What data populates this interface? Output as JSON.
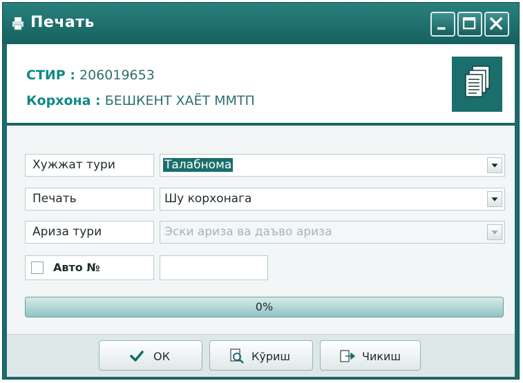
{
  "window": {
    "title": "Печать"
  },
  "header": {
    "stir_label": "СТИР :",
    "stir_value": "206019653",
    "company_label": "Корхона :",
    "company_value": "БЕШКЕНТ ХАЁТ ММТП"
  },
  "form": {
    "doc_type": {
      "label": "Хужжат тури",
      "value": "Талабнома"
    },
    "print": {
      "label": "Печать",
      "value": "Шу корхонага"
    },
    "request_type": {
      "label": "Ариза тури",
      "value": "Эски ариза ва даъво ариза",
      "disabled": true
    },
    "auto_number": {
      "label": "Авто №",
      "checked": false,
      "value": ""
    }
  },
  "progress": {
    "value": 0,
    "text": "0%"
  },
  "buttons": {
    "ok": "ОК",
    "view": "Кўриш",
    "exit": "Чикиш"
  },
  "icons": {
    "window": "printer-icon",
    "header": "documents-icon",
    "ok": "checkmark-icon",
    "view": "magnifier-document-icon",
    "exit": "exit-arrow-icon"
  },
  "colors": {
    "accent": "#1a6e6c",
    "title_gradient_top": "#2a807e",
    "label_text": "#0e8a86"
  }
}
